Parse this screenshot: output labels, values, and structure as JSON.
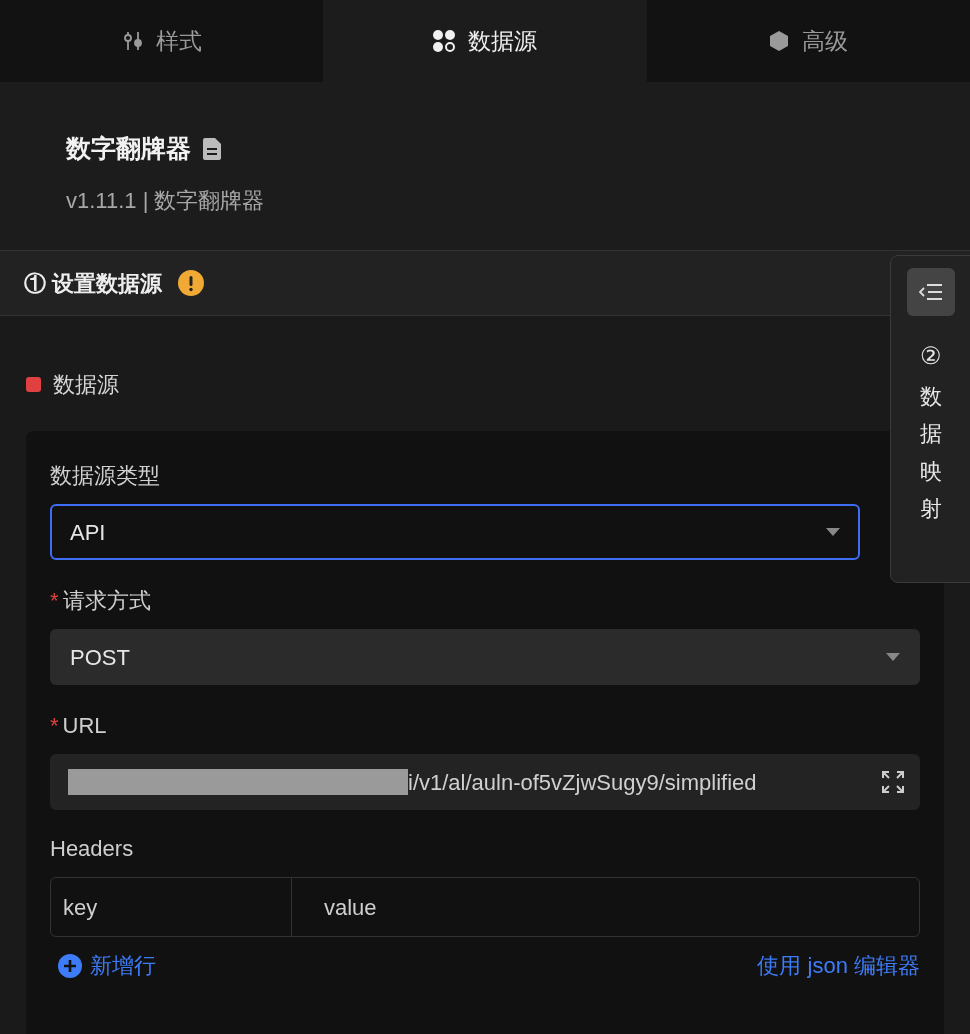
{
  "tabs": [
    {
      "label": "样式",
      "selected": false
    },
    {
      "label": "数据源",
      "selected": true
    },
    {
      "label": "高级",
      "selected": false
    }
  ],
  "component": {
    "name": "数字翻牌器",
    "meta": "v1.11.1 | 数字翻牌器"
  },
  "section": {
    "title": "① 设置数据源",
    "warning": true
  },
  "side_panel": {
    "step": "②",
    "label": "数据映射"
  },
  "group": {
    "label": "数据源",
    "color": "#e04040"
  },
  "fields": [
    {
      "kind": "select",
      "label": "数据源类型",
      "value": "API",
      "focused": true
    },
    {
      "kind": "select",
      "label": "请求方式",
      "required_mark": "*",
      "value": "POST",
      "focused": false
    },
    {
      "kind": "url",
      "label": "URL",
      "required_mark": "*",
      "value": "i/v1/al/auln-of5vZjwSugy9/simplified",
      "redacted": true
    }
  ],
  "headers": {
    "label": "Headers",
    "columns": [
      "key",
      "value"
    ],
    "add": "新增行",
    "json_editor": "使用 json 编辑器"
  }
}
